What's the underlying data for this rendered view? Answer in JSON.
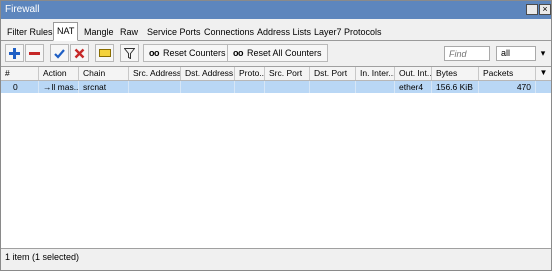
{
  "window": {
    "title": "Firewall"
  },
  "tabs": [
    "Filter Rules",
    "NAT",
    "Mangle",
    "Raw",
    "Service Ports",
    "Connections",
    "Address Lists",
    "Layer7 Protocols"
  ],
  "active_tab": "NAT",
  "toolbar": {
    "reset_counters_label": "Reset Counters",
    "reset_all_counters_label": "Reset All Counters",
    "oo_glyph": "oo",
    "find_placeholder": "Find",
    "filter_value": "all"
  },
  "columns": [
    "#",
    "Action",
    "Chain",
    "Src. Address",
    "Dst. Address",
    "Proto...",
    "Src. Port",
    "Dst. Port",
    "In. Inter...",
    "Out. Int...",
    "Bytes",
    "Packets"
  ],
  "rows": [
    {
      "num": "0",
      "action": "→ll mas...",
      "chain": "srcnat",
      "src_address": "",
      "dst_address": "",
      "protocol": "",
      "src_port": "",
      "dst_port": "",
      "in_interface": "",
      "out_interface": "ether4",
      "bytes": "156.6 KiB",
      "packets": "470",
      "selected": true
    }
  ],
  "status": "1 item (1 selected)",
  "colors": {
    "titlebar": "#5d86bd",
    "selected_row": "#b9d7f5",
    "add": "#1f5fc4",
    "remove": "#c62828",
    "check": "#1f5fc4"
  }
}
